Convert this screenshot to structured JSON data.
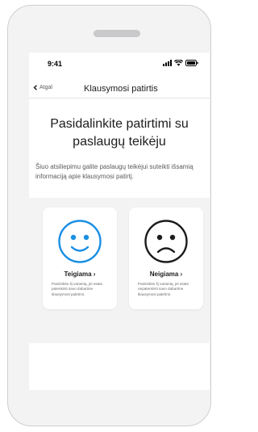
{
  "status_bar": {
    "time": "9:41",
    "icons": [
      "signal-icon",
      "wifi-icon",
      "battery-icon"
    ]
  },
  "nav": {
    "back_label": "Atgal",
    "title": "Klausymosi patirtis"
  },
  "main": {
    "heading": "Pasidalinkite patirtimi su paslaugų teikėju",
    "description": "Šiuo atsiliepimu galite paslaugų teikėjui suteikti išsamią informaciją apie klausymosi patirtį."
  },
  "cards": [
    {
      "label": "Teigiama ›",
      "description": "Pasirinkite šį variantą, jei esate patenkinti savo dabartine klausymosi patirtimi.",
      "icon": "happy-face-icon"
    },
    {
      "label": "Neigiama ›",
      "description": "Pasirinkite šį variantą, jei esate nepatenkinti savo dabartine klausymosi patirtimi.",
      "icon": "sad-face-icon"
    }
  ],
  "colors": {
    "accent": "#1a8fe3",
    "frame": "#f3f3f4",
    "text": "#1c1c1e",
    "muted": "#5b5b60"
  }
}
